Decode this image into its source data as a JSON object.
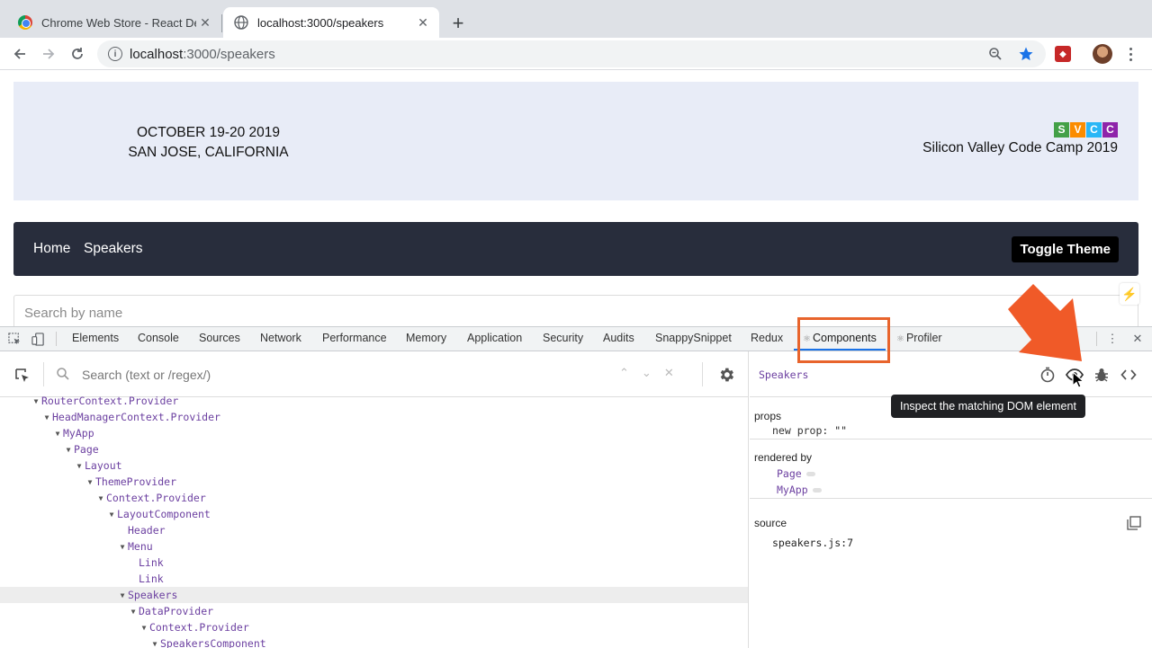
{
  "browser": {
    "tabs": [
      {
        "title": "Chrome Web Store - React Dev",
        "active": false,
        "icon": "chrome-store-icon"
      },
      {
        "title": "localhost:3000/speakers",
        "active": true,
        "icon": "globe-icon"
      }
    ],
    "address": {
      "host": "localhost",
      "path": ":3000/speakers"
    }
  },
  "page": {
    "date_line1": "OCTOBER 19-20  2019",
    "date_line2": "SAN JOSE, CALIFORNIA",
    "logo_letters": [
      {
        "letter": "S",
        "color": "#43a047"
      },
      {
        "letter": "V",
        "color": "#fb8c00"
      },
      {
        "letter": "C",
        "color": "#29b6f6"
      },
      {
        "letter": "C",
        "color": "#8e24aa"
      }
    ],
    "camp_name": "Silicon Valley Code Camp 2019",
    "nav": {
      "home": "Home",
      "speakers": "Speakers",
      "toggle_theme": "Toggle Theme"
    },
    "search_placeholder": "Search by name"
  },
  "devtools": {
    "tabs": [
      "Elements",
      "Console",
      "Sources",
      "Network",
      "Performance",
      "Memory",
      "Application",
      "Security",
      "Audits",
      "SnappySnippet",
      "Redux",
      "Components",
      "Profiler"
    ],
    "selected_tab": "Components",
    "search_placeholder": "Search (text or /regex/)",
    "tree": [
      {
        "name": "RouterContext.Provider",
        "depth": 0,
        "expanded": true
      },
      {
        "name": "HeadManagerContext.Provider",
        "depth": 1,
        "expanded": true
      },
      {
        "name": "MyApp",
        "depth": 2,
        "expanded": true
      },
      {
        "name": "Page",
        "depth": 3,
        "expanded": true
      },
      {
        "name": "Layout",
        "depth": 4,
        "expanded": true
      },
      {
        "name": "ThemeProvider",
        "depth": 5,
        "expanded": true
      },
      {
        "name": "Context.Provider",
        "depth": 6,
        "expanded": true
      },
      {
        "name": "LayoutComponent",
        "depth": 7,
        "expanded": true
      },
      {
        "name": "Header",
        "depth": 8,
        "expanded": false
      },
      {
        "name": "Menu",
        "depth": 8,
        "expanded": true
      },
      {
        "name": "Link",
        "depth": 9,
        "expanded": false
      },
      {
        "name": "Link",
        "depth": 9,
        "expanded": false
      },
      {
        "name": "Speakers",
        "depth": 8,
        "expanded": true,
        "selected": true
      },
      {
        "name": "DataProvider",
        "depth": 9,
        "expanded": true
      },
      {
        "name": "Context.Provider",
        "depth": 10,
        "expanded": true
      },
      {
        "name": "SpeakersComponent",
        "depth": 11,
        "expanded": true
      }
    ],
    "side": {
      "component_name": "Speakers",
      "tooltip": "Inspect the matching DOM element",
      "props_title": "props",
      "props": [
        {
          "key": "new prop",
          "sep": ": ",
          "value": "\"\""
        }
      ],
      "rendered_by_title": "rendered by",
      "owners": [
        "Page",
        "MyApp"
      ],
      "source_title": "source",
      "source_value": "speakers.js:7"
    }
  },
  "colors": {
    "highlight": "#e8642c",
    "accent": "#1a73e8",
    "component": "#6b3fa0"
  }
}
